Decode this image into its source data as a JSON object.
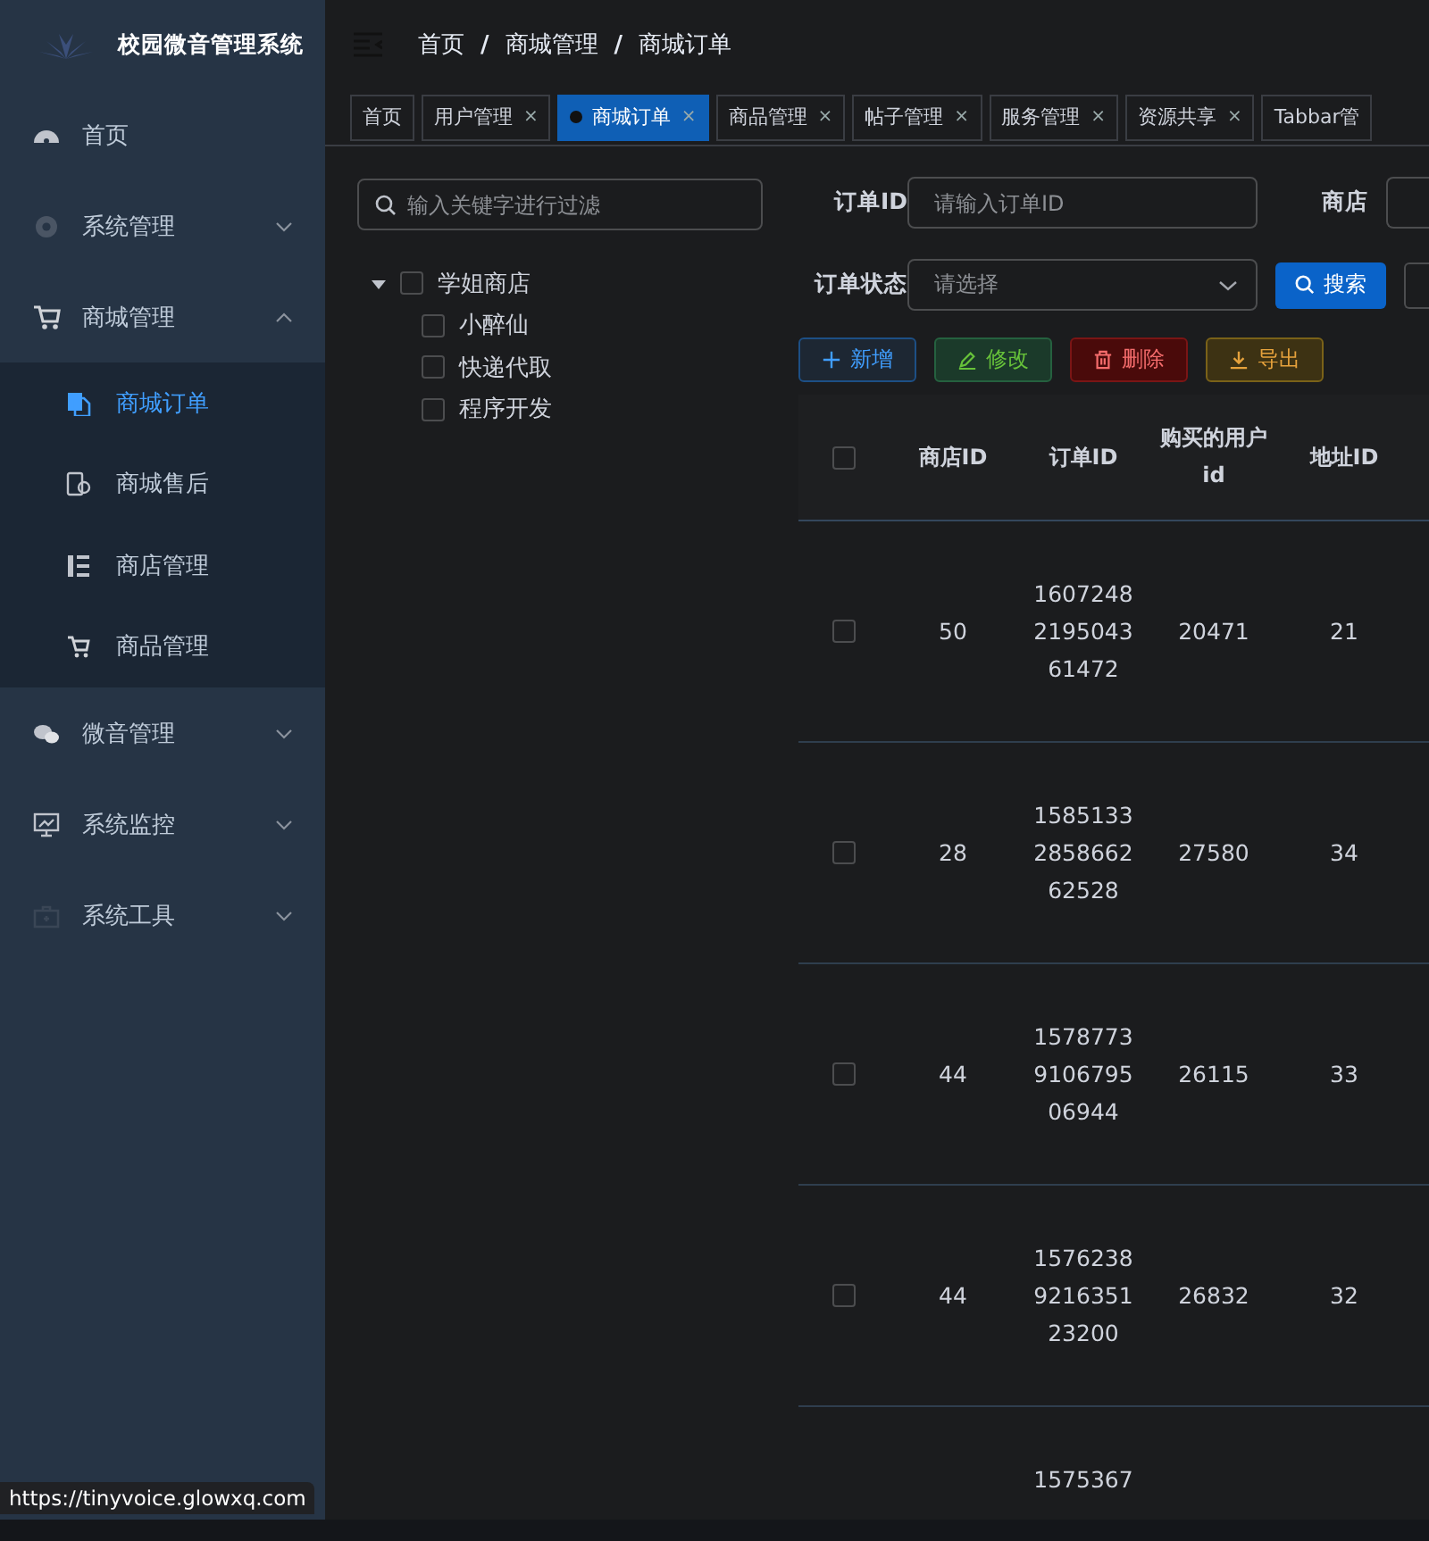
{
  "app": {
    "title": "校园微音管理系统"
  },
  "sidebar": {
    "items": [
      {
        "label": "首页"
      },
      {
        "label": "系统管理",
        "expanded": false
      },
      {
        "label": "商城管理",
        "expanded": true,
        "children": [
          {
            "label": "商城订单",
            "selected": true
          },
          {
            "label": "商城售后",
            "selected": false
          },
          {
            "label": "商店管理",
            "selected": false
          },
          {
            "label": "商品管理",
            "selected": false
          }
        ]
      },
      {
        "label": "微音管理",
        "expanded": false
      },
      {
        "label": "系统监控",
        "expanded": false
      },
      {
        "label": "系统工具",
        "expanded": false
      }
    ]
  },
  "breadcrumb": [
    {
      "label": "首页"
    },
    {
      "separator": "/",
      "label": "商城管理"
    },
    {
      "separator": "/",
      "label": "商城订单"
    }
  ],
  "tabs": [
    {
      "label": "首页",
      "selected": false
    },
    {
      "label": "用户管理",
      "close": "×",
      "selected": false
    },
    {
      "label": "商城订单",
      "close": "×",
      "selected": true
    },
    {
      "label": "商品管理",
      "close": "×",
      "selected": false
    },
    {
      "label": "帖子管理",
      "close": "×",
      "selected": false
    },
    {
      "label": "服务管理",
      "close": "×",
      "selected": false
    },
    {
      "label": "资源共享",
      "close": "×",
      "selected": false
    },
    {
      "label": "Tabbar管",
      "selected": false
    }
  ],
  "tree": {
    "placeholder": "输入关键字进行过滤",
    "nodes": [
      {
        "label": "学姐商店",
        "checked": false,
        "expanded": true,
        "children": [
          {
            "label": "小醉仙",
            "checked": false
          },
          {
            "label": "快递代取",
            "checked": false
          },
          {
            "label": "程序开发",
            "checked": false
          }
        ]
      }
    ]
  },
  "filters": {
    "order_id_label": "订单ID",
    "order_id_placeholder": "请输入订单ID",
    "shop_label": "商店",
    "status_label": "订单状态",
    "status_placeholder": "请选择",
    "search_button": "搜索"
  },
  "actions": [
    {
      "label": "新增",
      "kind": "add"
    },
    {
      "label": "修改",
      "kind": "edit"
    },
    {
      "label": "删除",
      "kind": "delete"
    },
    {
      "label": "导出",
      "kind": "export"
    }
  ],
  "table": {
    "all_checked": false,
    "columns": [
      "商店ID",
      "订单ID",
      "购买的用户id",
      "地址ID"
    ],
    "rows": [
      {
        "checked": false,
        "cells": [
          "50",
          "1607248219504361472",
          "20471",
          "21"
        ]
      },
      {
        "checked": false,
        "cells": [
          "28",
          "1585133285866262528",
          "27580",
          "34"
        ]
      },
      {
        "checked": false,
        "cells": [
          "44",
          "1578773910679506944",
          "26115",
          "33"
        ]
      },
      {
        "checked": false,
        "cells": [
          "44",
          "1576238921635123200",
          "26832",
          "32"
        ]
      },
      {
        "cells": [
          "",
          "1575367",
          "",
          ""
        ]
      }
    ]
  },
  "status_url": "https://tinyvoice.glowxq.com"
}
